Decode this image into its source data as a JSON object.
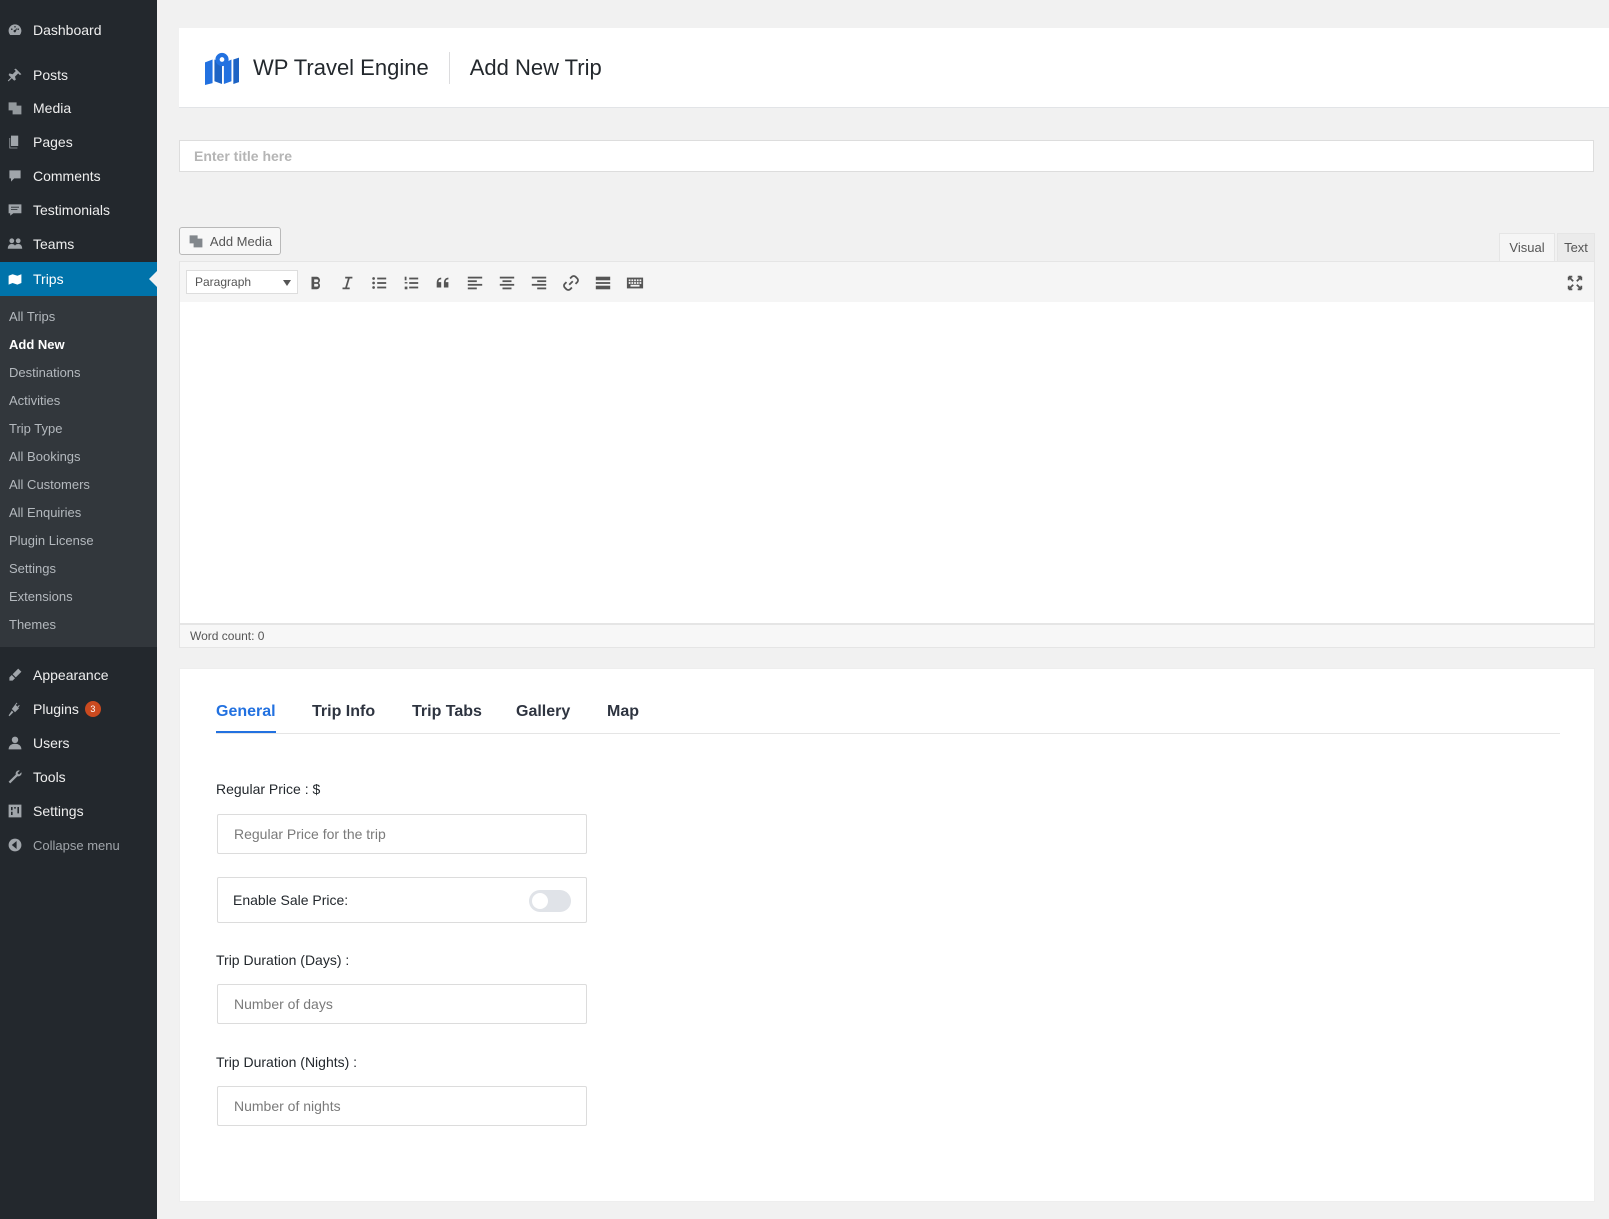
{
  "sidebar": {
    "items": [
      {
        "label": "Dashboard",
        "icon": "dashboard-icon"
      },
      {
        "label": "Posts",
        "icon": "pin-icon"
      },
      {
        "label": "Media",
        "icon": "media-icon"
      },
      {
        "label": "Pages",
        "icon": "pages-icon"
      },
      {
        "label": "Comments",
        "icon": "comment-icon"
      },
      {
        "label": "Testimonials",
        "icon": "testimonial-icon"
      },
      {
        "label": "Teams",
        "icon": "teams-icon"
      },
      {
        "label": "Trips",
        "icon": "map-icon"
      }
    ],
    "trips_submenu": [
      {
        "label": "All Trips"
      },
      {
        "label": "Add New"
      },
      {
        "label": "Destinations"
      },
      {
        "label": "Activities"
      },
      {
        "label": "Trip Type"
      },
      {
        "label": "All Bookings"
      },
      {
        "label": "All Customers"
      },
      {
        "label": "All Enquiries"
      },
      {
        "label": "Plugin License"
      },
      {
        "label": "Settings"
      },
      {
        "label": "Extensions"
      },
      {
        "label": "Themes"
      }
    ],
    "lower_items": [
      {
        "label": "Appearance",
        "icon": "brush-icon"
      },
      {
        "label": "Plugins",
        "icon": "plugin-icon",
        "badge": "3"
      },
      {
        "label": "Users",
        "icon": "user-icon"
      },
      {
        "label": "Tools",
        "icon": "wrench-icon"
      },
      {
        "label": "Settings",
        "icon": "settings-icon"
      }
    ],
    "collapse_label": "Collapse menu",
    "active_color": "#0073aa",
    "badge_color": "#ca4a1f"
  },
  "header": {
    "brand": "WP Travel Engine",
    "page_title": "Add New Trip",
    "logo_color": "#2271e0"
  },
  "title_input": {
    "placeholder": "Enter title here",
    "value": ""
  },
  "editor": {
    "add_media_label": "Add Media",
    "tabs": {
      "visual": "Visual",
      "text": "Text"
    },
    "format_select": "Paragraph",
    "word_count": "Word count: 0",
    "toolbar_icons": [
      "bold-icon",
      "italic-icon",
      "bullet-list-icon",
      "numbered-list-icon",
      "blockquote-icon",
      "align-left-icon",
      "align-center-icon",
      "align-right-icon",
      "link-icon",
      "read-more-icon",
      "toolbar-toggle-icon"
    ]
  },
  "meta": {
    "tabs": [
      {
        "label": "General"
      },
      {
        "label": "Trip Info"
      },
      {
        "label": "Trip Tabs"
      },
      {
        "label": "Gallery"
      },
      {
        "label": "Map"
      }
    ],
    "active_tab_color": "#2271e0",
    "regular_price": {
      "label": "Regular Price : $",
      "placeholder": "Regular Price for the trip",
      "value": ""
    },
    "sale_price": {
      "label": "Enable Sale Price:",
      "enabled": false
    },
    "duration_days": {
      "label": "Trip Duration (Days) :",
      "placeholder": "Number of days",
      "value": ""
    },
    "duration_nights": {
      "label": "Trip Duration (Nights) :",
      "placeholder": "Number of nights",
      "value": ""
    }
  }
}
